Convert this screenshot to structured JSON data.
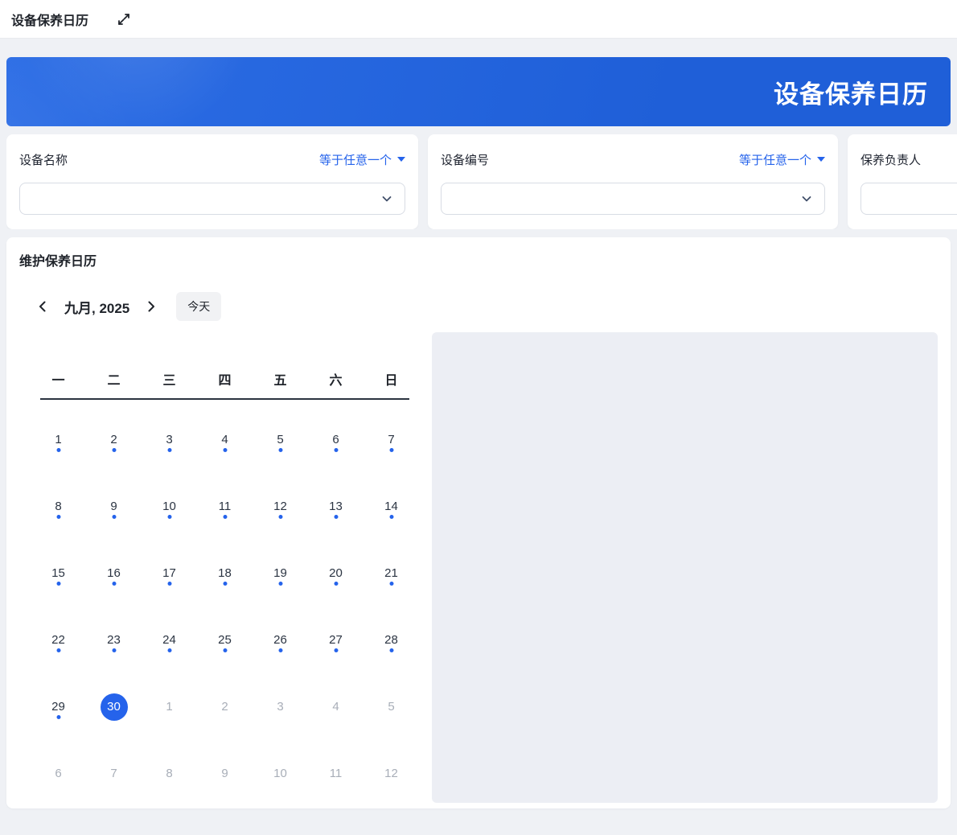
{
  "topbar": {
    "title": "设备保养日历"
  },
  "banner": {
    "title": "设备保养日历"
  },
  "filters": [
    {
      "label": "设备名称",
      "operator": "等于任意一个",
      "value": ""
    },
    {
      "label": "设备编号",
      "operator": "等于任意一个",
      "value": ""
    },
    {
      "label": "保养负责人",
      "operator": "",
      "value": ""
    }
  ],
  "calendar": {
    "section_title": "维护保养日历",
    "month_label": "九月, 2025",
    "today_label": "今天",
    "weekdays": [
      "一",
      "二",
      "三",
      "四",
      "五",
      "六",
      "日"
    ],
    "selected_day": "30",
    "weeks": [
      [
        {
          "d": "1",
          "cur": true,
          "dot": true
        },
        {
          "d": "2",
          "cur": true,
          "dot": true
        },
        {
          "d": "3",
          "cur": true,
          "dot": true
        },
        {
          "d": "4",
          "cur": true,
          "dot": true
        },
        {
          "d": "5",
          "cur": true,
          "dot": true
        },
        {
          "d": "6",
          "cur": true,
          "dot": true
        },
        {
          "d": "7",
          "cur": true,
          "dot": true
        }
      ],
      [
        {
          "d": "8",
          "cur": true,
          "dot": true
        },
        {
          "d": "9",
          "cur": true,
          "dot": true
        },
        {
          "d": "10",
          "cur": true,
          "dot": true
        },
        {
          "d": "11",
          "cur": true,
          "dot": true
        },
        {
          "d": "12",
          "cur": true,
          "dot": true
        },
        {
          "d": "13",
          "cur": true,
          "dot": true
        },
        {
          "d": "14",
          "cur": true,
          "dot": true
        }
      ],
      [
        {
          "d": "15",
          "cur": true,
          "dot": true
        },
        {
          "d": "16",
          "cur": true,
          "dot": true
        },
        {
          "d": "17",
          "cur": true,
          "dot": true
        },
        {
          "d": "18",
          "cur": true,
          "dot": true
        },
        {
          "d": "19",
          "cur": true,
          "dot": true
        },
        {
          "d": "20",
          "cur": true,
          "dot": true
        },
        {
          "d": "21",
          "cur": true,
          "dot": true
        }
      ],
      [
        {
          "d": "22",
          "cur": true,
          "dot": true
        },
        {
          "d": "23",
          "cur": true,
          "dot": true
        },
        {
          "d": "24",
          "cur": true,
          "dot": true
        },
        {
          "d": "25",
          "cur": true,
          "dot": true
        },
        {
          "d": "26",
          "cur": true,
          "dot": true
        },
        {
          "d": "27",
          "cur": true,
          "dot": true
        },
        {
          "d": "28",
          "cur": true,
          "dot": true
        }
      ],
      [
        {
          "d": "29",
          "cur": true,
          "dot": true
        },
        {
          "d": "30",
          "cur": true,
          "dot": false,
          "sel": true
        },
        {
          "d": "1",
          "cur": false
        },
        {
          "d": "2",
          "cur": false
        },
        {
          "d": "3",
          "cur": false
        },
        {
          "d": "4",
          "cur": false
        },
        {
          "d": "5",
          "cur": false
        }
      ],
      [
        {
          "d": "6",
          "cur": false
        },
        {
          "d": "7",
          "cur": false
        },
        {
          "d": "8",
          "cur": false
        },
        {
          "d": "9",
          "cur": false
        },
        {
          "d": "10",
          "cur": false
        },
        {
          "d": "11",
          "cur": false
        },
        {
          "d": "12",
          "cur": false
        }
      ]
    ]
  },
  "colors": {
    "accent": "#2563eb",
    "banner_start": "#2c6de5",
    "banner_end": "#1f5fd8",
    "panel": "#eceef4"
  }
}
